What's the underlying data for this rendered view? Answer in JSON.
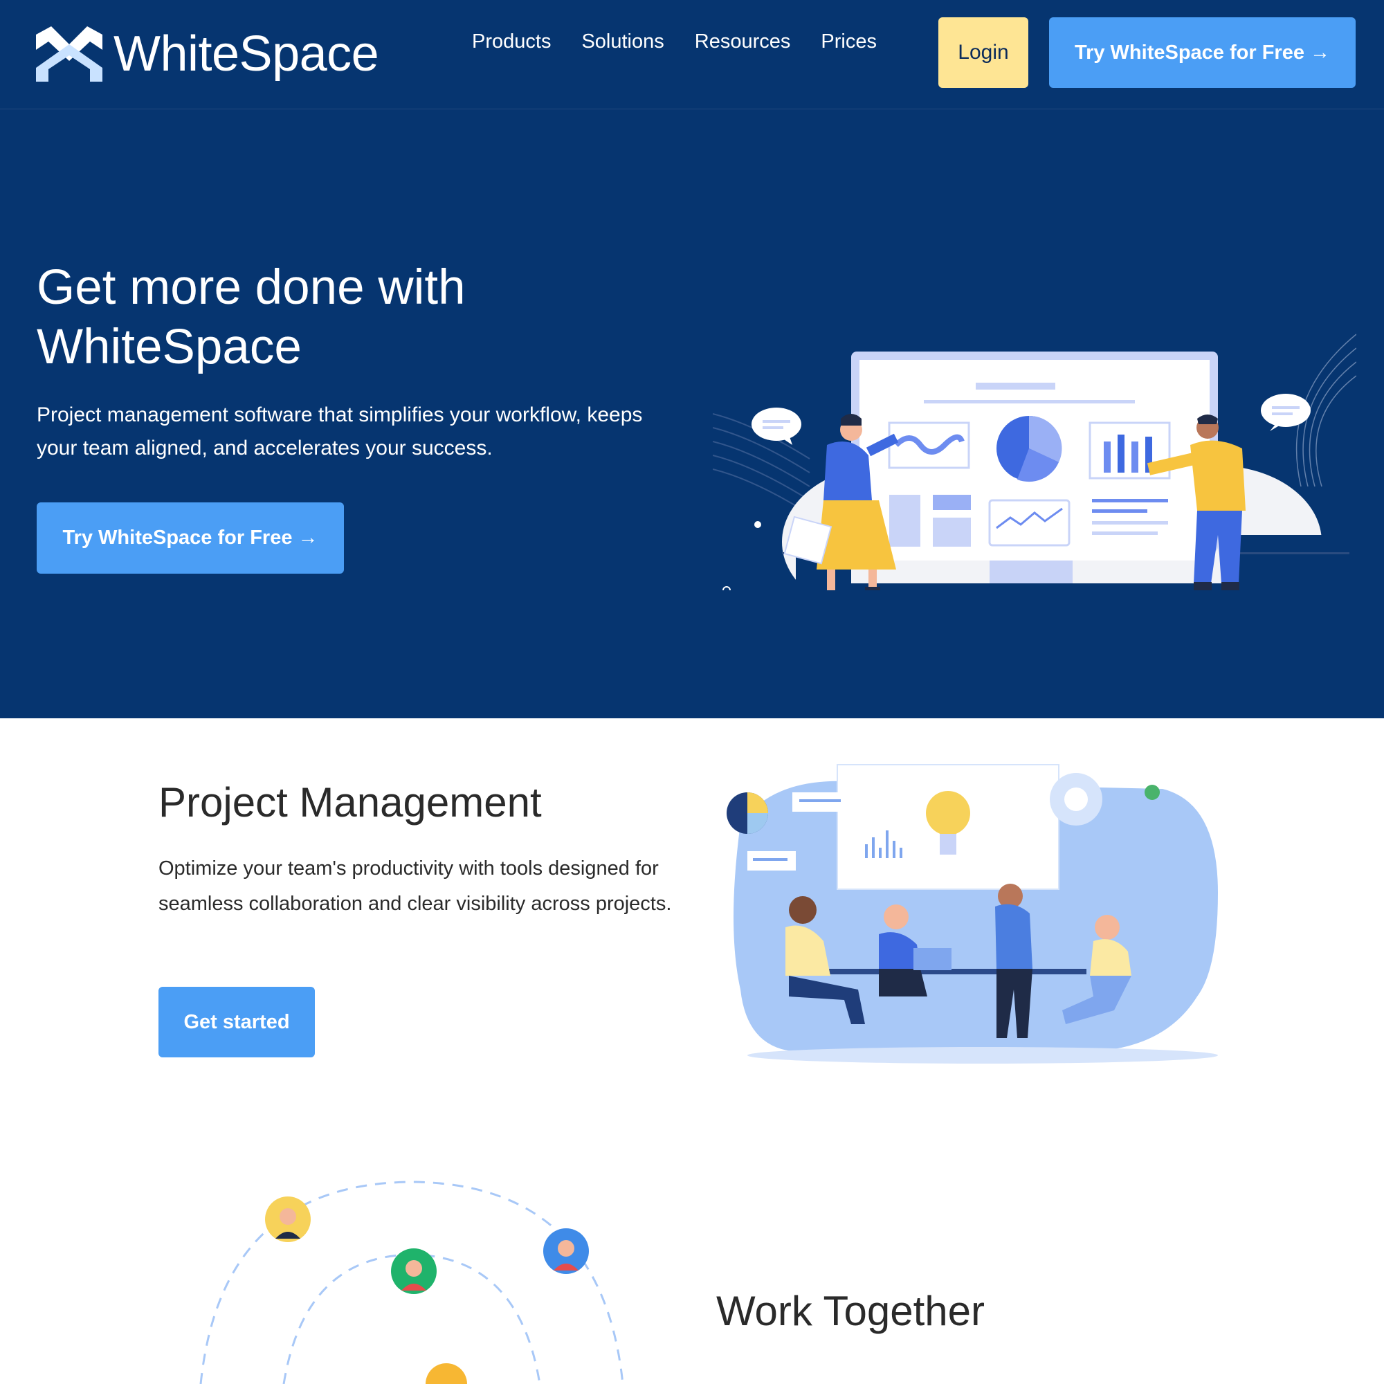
{
  "brand": {
    "name": "WhiteSpace",
    "primary_color": "#063570",
    "accent_color": "#4b9ef5",
    "login_color": "#fee594"
  },
  "nav": {
    "items": [
      {
        "label": "Products"
      },
      {
        "label": "Solutions"
      },
      {
        "label": "Resources"
      },
      {
        "label": "Prices"
      }
    ],
    "login_label": "Login",
    "cta_label": "Try WhiteSpace for Free →"
  },
  "hero": {
    "title": "Get more done with WhiteSpace",
    "subtitle": "Project management software that simplifies your workflow, keeps your team aligned, and accelerates your success.",
    "cta_label": "Try WhiteSpace for Free →",
    "illustration": "team-dashboard-illustration"
  },
  "project_management": {
    "title": "Project Management",
    "text": "Optimize your team's productivity with tools designed for seamless collaboration and clear visibility across projects.",
    "cta_label": "Get started",
    "illustration": "team-meeting-illustration"
  },
  "work_together": {
    "title": "Work Together",
    "illustration": "orbit-avatars-illustration"
  }
}
